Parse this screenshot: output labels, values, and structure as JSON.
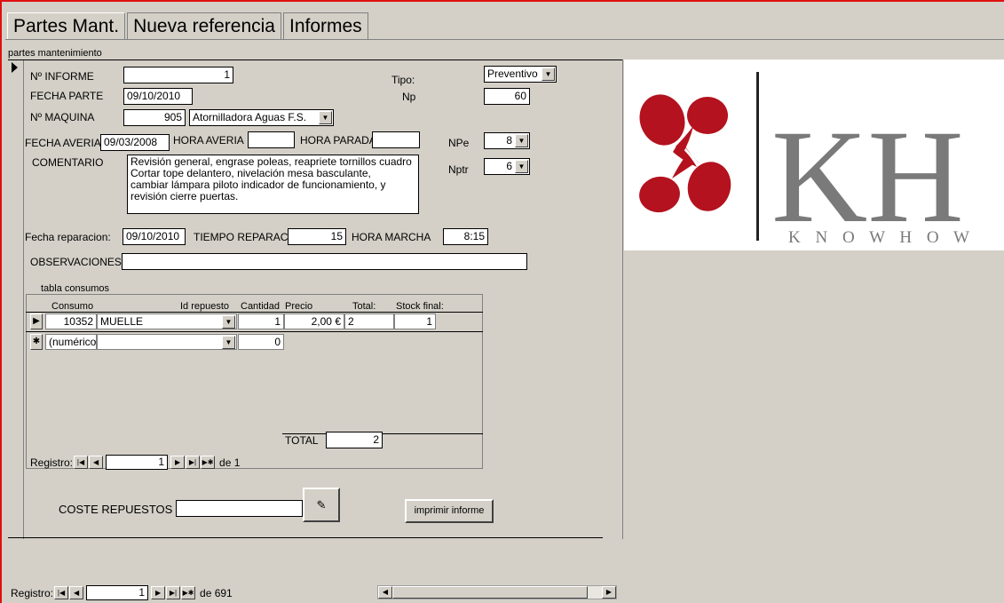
{
  "tabs": [
    {
      "label": "Partes Mant."
    },
    {
      "label": "Nueva referencia"
    },
    {
      "label": "Informes"
    }
  ],
  "form_caption": "partes mantenimiento",
  "fields": {
    "n_informe": {
      "label": "Nº INFORME",
      "value": "1"
    },
    "fecha_parte": {
      "label": "FECHA PARTE",
      "value": "09/10/2010"
    },
    "n_maquina": {
      "label": "Nº MAQUINA",
      "value": "905",
      "name": "Atornilladora Aguas F.S."
    },
    "tipo": {
      "label": "Tipo:",
      "value": "Preventivo"
    },
    "np": {
      "label": "Np",
      "value": "60"
    },
    "fecha_averia": {
      "label": "FECHA AVERIA",
      "value": "09/03/2008"
    },
    "hora_averia": {
      "label": "HORA AVERIA",
      "value": ""
    },
    "hora_parada": {
      "label": "HORA PARADA",
      "value": ""
    },
    "npe": {
      "label": "NPe",
      "value": "8"
    },
    "nptr": {
      "label": "Nptr",
      "value": "6"
    },
    "comentario": {
      "label": "COMENTARIO",
      "lines": [
        "Revisión general, engrase poleas, reapriete tornillos cuadro",
        "Cortar tope delantero, nivelación mesa basculante,",
        "cambiar lámpara piloto indicador de funcionamiento, y",
        "revisión cierre puertas."
      ]
    },
    "fecha_reparacion": {
      "label": "Fecha reparacion:",
      "value": "09/10/2010"
    },
    "tiempo_reparacion": {
      "label": "TIEMPO REPARAC(",
      "value": "15"
    },
    "hora_marcha": {
      "label": "HORA MARCHA",
      "value": "8:15"
    },
    "observaciones": {
      "label": "OBSERVACIONES",
      "value": ""
    }
  },
  "subform": {
    "caption": "tabla consumos",
    "headers": {
      "consumo": "Consumo",
      "id_repuesto": "Id repuesto",
      "cantidad": "Cantidad",
      "precio": "Precio",
      "total": "Total:",
      "stock": "Stock final:"
    },
    "row": {
      "consumo": "10352",
      "repuesto": "MUELLE",
      "cantidad": "1",
      "precio": "2,00 €",
      "total": "2",
      "stock": "1"
    },
    "new_row": {
      "consumo": "(numérico)",
      "cantidad": "0"
    },
    "total_label": "TOTAL",
    "total_value": "2",
    "nav": {
      "label": "Registro:",
      "current": "1",
      "of": "de 1"
    }
  },
  "coste_repuestos": {
    "label": "COSTE REPUESTOS",
    "value": ""
  },
  "print_button": "imprimir informe",
  "main_nav": {
    "label": "Registro:",
    "current": "1",
    "of": "de 691"
  },
  "logo": {
    "letters": "KH",
    "tagline": "K N O W   H O W",
    "brand_red": "#b3121e",
    "brand_gray": "#7a7a7a"
  }
}
